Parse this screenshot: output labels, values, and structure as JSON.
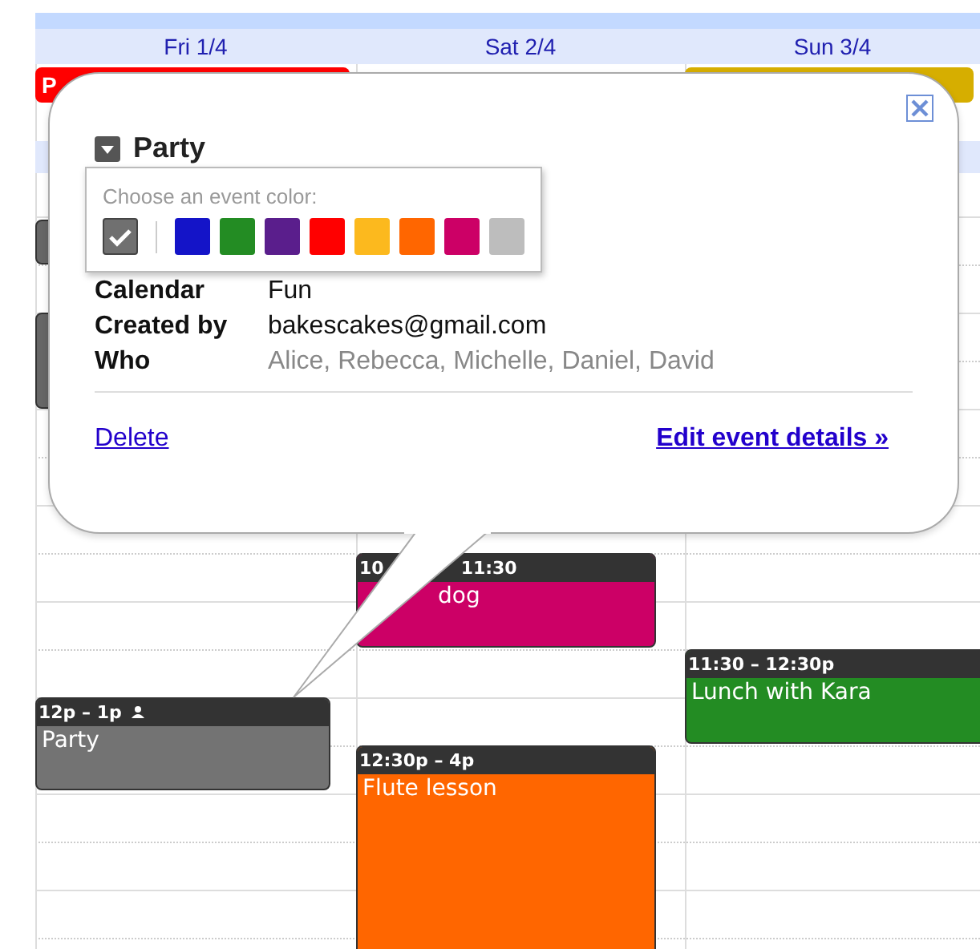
{
  "days": [
    {
      "label": "Fri 1/4",
      "all_day": {
        "title": "P",
        "color": "#ff0000"
      },
      "events": [
        {
          "color": "#666666",
          "guests": false
        },
        {
          "color": "#666666",
          "guests": false
        },
        {
          "time_parts": [
            "12p – 1p"
          ],
          "title": "Party",
          "color": "#737373",
          "guests": true
        }
      ]
    },
    {
      "label": "Sat 2/4",
      "events": [
        {
          "time_parts": [
            "10",
            "11:30"
          ],
          "title": "dog",
          "color": "#cc0066",
          "guests": false
        },
        {
          "time_parts": [
            "12:30p – 4p"
          ],
          "title": "Flute lesson",
          "color": "#ff6600",
          "guests": false
        }
      ]
    },
    {
      "label": "Sun 3/4",
      "all_day": {
        "color": "#d6ae00"
      },
      "events": [
        {
          "time_parts": [
            "11:30 – 12:30p"
          ],
          "title": "Lunch with Kara",
          "color": "#238c23",
          "guests": false
        }
      ]
    }
  ],
  "popup": {
    "title": "Party",
    "color_picker": {
      "label": "Choose an event color:",
      "swatches": [
        {
          "color": "#707070",
          "selected": true
        },
        {
          "color": "#1414c8",
          "selected": false
        },
        {
          "color": "#238c23",
          "selected": false
        },
        {
          "color": "#5a1e8c",
          "selected": false
        },
        {
          "color": "#ff0000",
          "selected": false
        },
        {
          "color": "#fcb91e",
          "selected": false
        },
        {
          "color": "#ff6600",
          "selected": false
        },
        {
          "color": "#cc0066",
          "selected": false
        },
        {
          "color": "#bdbdbd",
          "selected": false
        }
      ]
    },
    "details": [
      {
        "label": "Calendar",
        "value": "Fun",
        "muted": false
      },
      {
        "label": "Created by",
        "value": "bakescakes@gmail.com",
        "muted": false
      },
      {
        "label": "Who",
        "value": "Alice, Rebecca, Michelle, Daniel, David",
        "muted": true
      }
    ],
    "delete_link": "Delete",
    "edit_link": "Edit event details »"
  }
}
